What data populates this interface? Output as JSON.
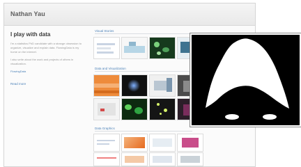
{
  "header": {
    "title": "Nathan Yau"
  },
  "about": {
    "heading": "I play with data",
    "paragraph_1": "I'm a statistics PhD candidate with a strange obsession to organize, visualize and explain data. FlowingData is my home on the internet.",
    "paragraph_2": "I also write about the work and projects of others in visualization.",
    "link": "FlowingData",
    "bio_link": "Read more"
  },
  "sections": [
    {
      "label": "Visual Stories"
    },
    {
      "label": "Data and Visualization"
    },
    {
      "label": "Data Graphics"
    }
  ],
  "photo": {
    "name": "hair-silhouette-photo"
  }
}
